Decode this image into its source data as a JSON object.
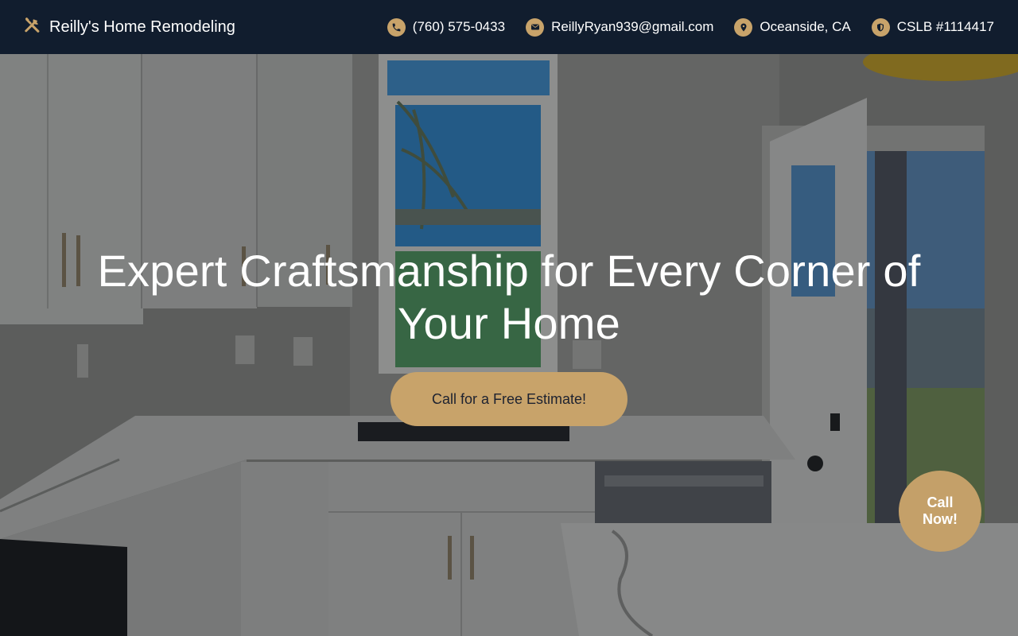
{
  "header": {
    "brand_icon": "tools-icon",
    "brand_name": "Reilly's Home Remodeling",
    "contacts": [
      {
        "icon": "phone-icon",
        "text": "(760) 575-0433"
      },
      {
        "icon": "mail-icon",
        "text": "ReillyRyan939@gmail.com"
      },
      {
        "icon": "location-pin-icon",
        "text": "Oceanside, CA"
      },
      {
        "icon": "shield-icon",
        "text": "CSLB #1114417"
      }
    ]
  },
  "hero": {
    "title": "Expert Craftsmanship for Every Corner of Your Home",
    "cta_label": "Call for a Free Estimate!",
    "background": "kitchen-remodel-photo"
  },
  "floating": {
    "call_now_label": "Call\nNow!"
  },
  "colors": {
    "header_bg": "#111d2e",
    "accent": "#c8a36a",
    "text_light": "#ffffff"
  }
}
